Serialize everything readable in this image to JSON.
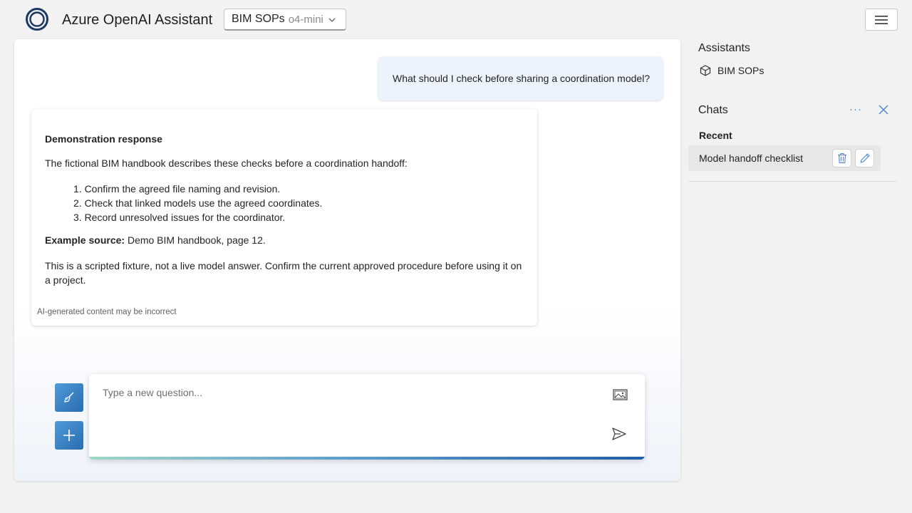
{
  "header": {
    "app_title": "Azure OpenAI Assistant",
    "assistant_selector": {
      "assistant": "BIM SOPs",
      "model": "o4-mini"
    },
    "menu_icon": "hamburger-icon",
    "brand_color": "#1f3864"
  },
  "conversation": {
    "user_message": "What should I check before sharing a coordination model?",
    "response": {
      "title": "Demonstration response",
      "intro": "The fictional BIM handbook describes these checks before a coordination handoff:",
      "steps": [
        "1. Confirm the agreed file naming and revision.",
        "2. Check that linked models use the agreed coordinates.",
        "3. Record unresolved issues for the coordinator."
      ],
      "source_label": "Example source:",
      "source_value": " Demo BIM handbook, page 12.",
      "note": "This is a scripted fixture, not a live model answer. Confirm the current approved procedure before using it on a project.",
      "disclaimer": "AI-generated content may be incorrect"
    }
  },
  "composer": {
    "placeholder": "Type a new question...",
    "image_icon": "image-icon",
    "send_icon": "send-icon",
    "clear_icon": "broom-icon",
    "new_icon": "plus-icon"
  },
  "sidebar": {
    "assistants_title": "Assistants",
    "assistants": [
      {
        "label": "BIM SOPs",
        "icon": "cube-icon"
      }
    ],
    "chats_title": "Chats",
    "more_label": "···",
    "recent_label": "Recent",
    "chats": [
      {
        "label": "Model handoff checklist"
      }
    ]
  }
}
